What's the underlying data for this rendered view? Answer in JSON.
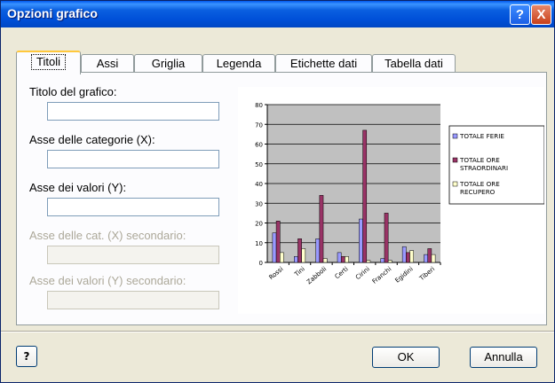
{
  "window": {
    "title": "Opzioni grafico",
    "help_glyph": "?",
    "close_glyph": "X"
  },
  "tabs": [
    "Titoli",
    "Assi",
    "Griglia",
    "Legenda",
    "Etichette dati",
    "Tabella dati"
  ],
  "form": {
    "chart_title_label": "Titolo del grafico:",
    "x_axis_label": "Asse delle categorie (X):",
    "y_axis_label": "Asse dei valori (Y):",
    "x2_axis_label": "Asse delle cat. (X) secondario:",
    "y2_axis_label": "Asse dei valori (Y) secondario:",
    "chart_title_value": "",
    "x_axis_value": "",
    "y_axis_value": "",
    "x2_axis_value": "",
    "y2_axis_value": ""
  },
  "buttons": {
    "help_glyph": "?",
    "ok": "OK",
    "cancel": "Annulla"
  },
  "chart_data": {
    "type": "bar",
    "categories": [
      "Rossi",
      "Tini",
      "Zabboli",
      "Certi",
      "Cirini",
      "Franchi",
      "Egidini",
      "Tiberi"
    ],
    "series": [
      {
        "name": "TOTALE FERIE",
        "color": "#9999ff",
        "values": [
          15,
          3,
          12,
          5,
          22,
          2,
          8,
          4
        ]
      },
      {
        "name": "TOTALE ORE STRAORDINARI",
        "color": "#993366",
        "values": [
          21,
          12,
          34,
          3,
          67,
          25,
          5,
          7
        ]
      },
      {
        "name": "TOTALE ORE RECUPERO",
        "color": "#ffffcc",
        "values": [
          5,
          7,
          2,
          3,
          1,
          1,
          6,
          4
        ]
      }
    ],
    "legend_lines": [
      [
        "TOTALE FERIE"
      ],
      [
        "TOTALE ORE",
        "STRAORDINARI"
      ],
      [
        "TOTALE ORE",
        "RECUPERO"
      ]
    ],
    "ylim": [
      0,
      80
    ],
    "yticks": [
      0,
      10,
      20,
      30,
      40,
      50,
      60,
      70,
      80
    ],
    "plot_bg": "#c0c0c0",
    "grid": true,
    "legend_position": "right"
  }
}
